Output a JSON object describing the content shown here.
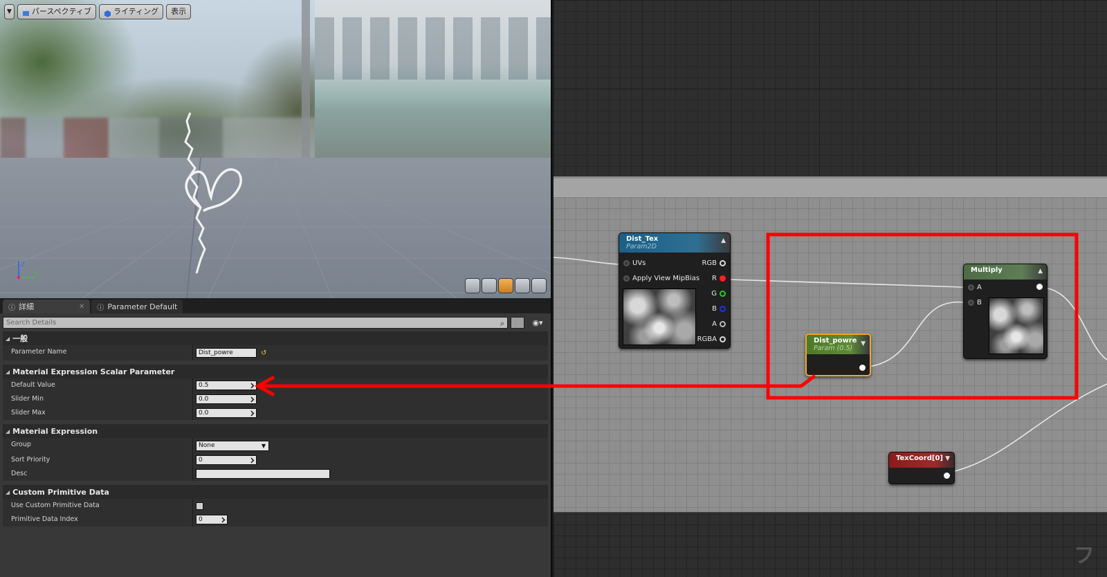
{
  "viewport": {
    "toolbar": {
      "menu_icon": "dropdown-arrow-icon",
      "perspective_label": "パースペクティブ",
      "lighting_label": "ライティング",
      "show_label": "表示"
    },
    "axis": {
      "z": "Z",
      "y": "Y"
    },
    "view_buttons": [
      "cylinder-icon",
      "sphere-icon",
      "plane-icon",
      "cube-icon",
      "custom-mesh-icon"
    ]
  },
  "details": {
    "tabs": [
      {
        "label": "詳細",
        "icon": "info-icon"
      },
      {
        "label": "Parameter Default",
        "icon": "info-icon"
      }
    ],
    "search_placeholder": "Search Details",
    "sections": {
      "general": {
        "title": "一般",
        "param_name_label": "Parameter Name",
        "param_name_value": "Dist_powre"
      },
      "scalar": {
        "title": "Material Expression Scalar Parameter",
        "default_label": "Default Value",
        "default_value": "0.5",
        "slider_min_label": "Slider Min",
        "slider_min_value": "0.0",
        "slider_max_label": "Slider Max",
        "slider_max_value": "0.0"
      },
      "expression": {
        "title": "Material Expression",
        "group_label": "Group",
        "group_value": "None",
        "sort_label": "Sort Priority",
        "sort_value": "0",
        "desc_label": "Desc",
        "desc_value": ""
      },
      "primitive": {
        "title": "Custom Primitive Data",
        "use_label": "Use Custom Primitive Data",
        "use_checked": false,
        "index_label": "Primitive Data Index",
        "index_value": "0"
      }
    }
  },
  "graph": {
    "dist_tex": {
      "title": "Dist_Tex",
      "subtitle": "Param2D",
      "inputs": [
        "UVs",
        "Apply View MipBias"
      ],
      "outputs": [
        "RGB",
        "R",
        "G",
        "B",
        "A",
        "RGBA"
      ],
      "header_color": "#1b5f87"
    },
    "dist_powre": {
      "title": "Dist_powre",
      "subtitle": "Param (0.5)",
      "header_color": "#4d7a2a"
    },
    "multiply": {
      "title": "Multiply",
      "inputs": [
        "A",
        "B"
      ],
      "header_color": "#4e6b45"
    },
    "texcoord": {
      "title": "TexCoord[0]",
      "header_color": "#8b1c1c"
    },
    "annotation_color": "#ff0000",
    "watermark": "フ"
  }
}
